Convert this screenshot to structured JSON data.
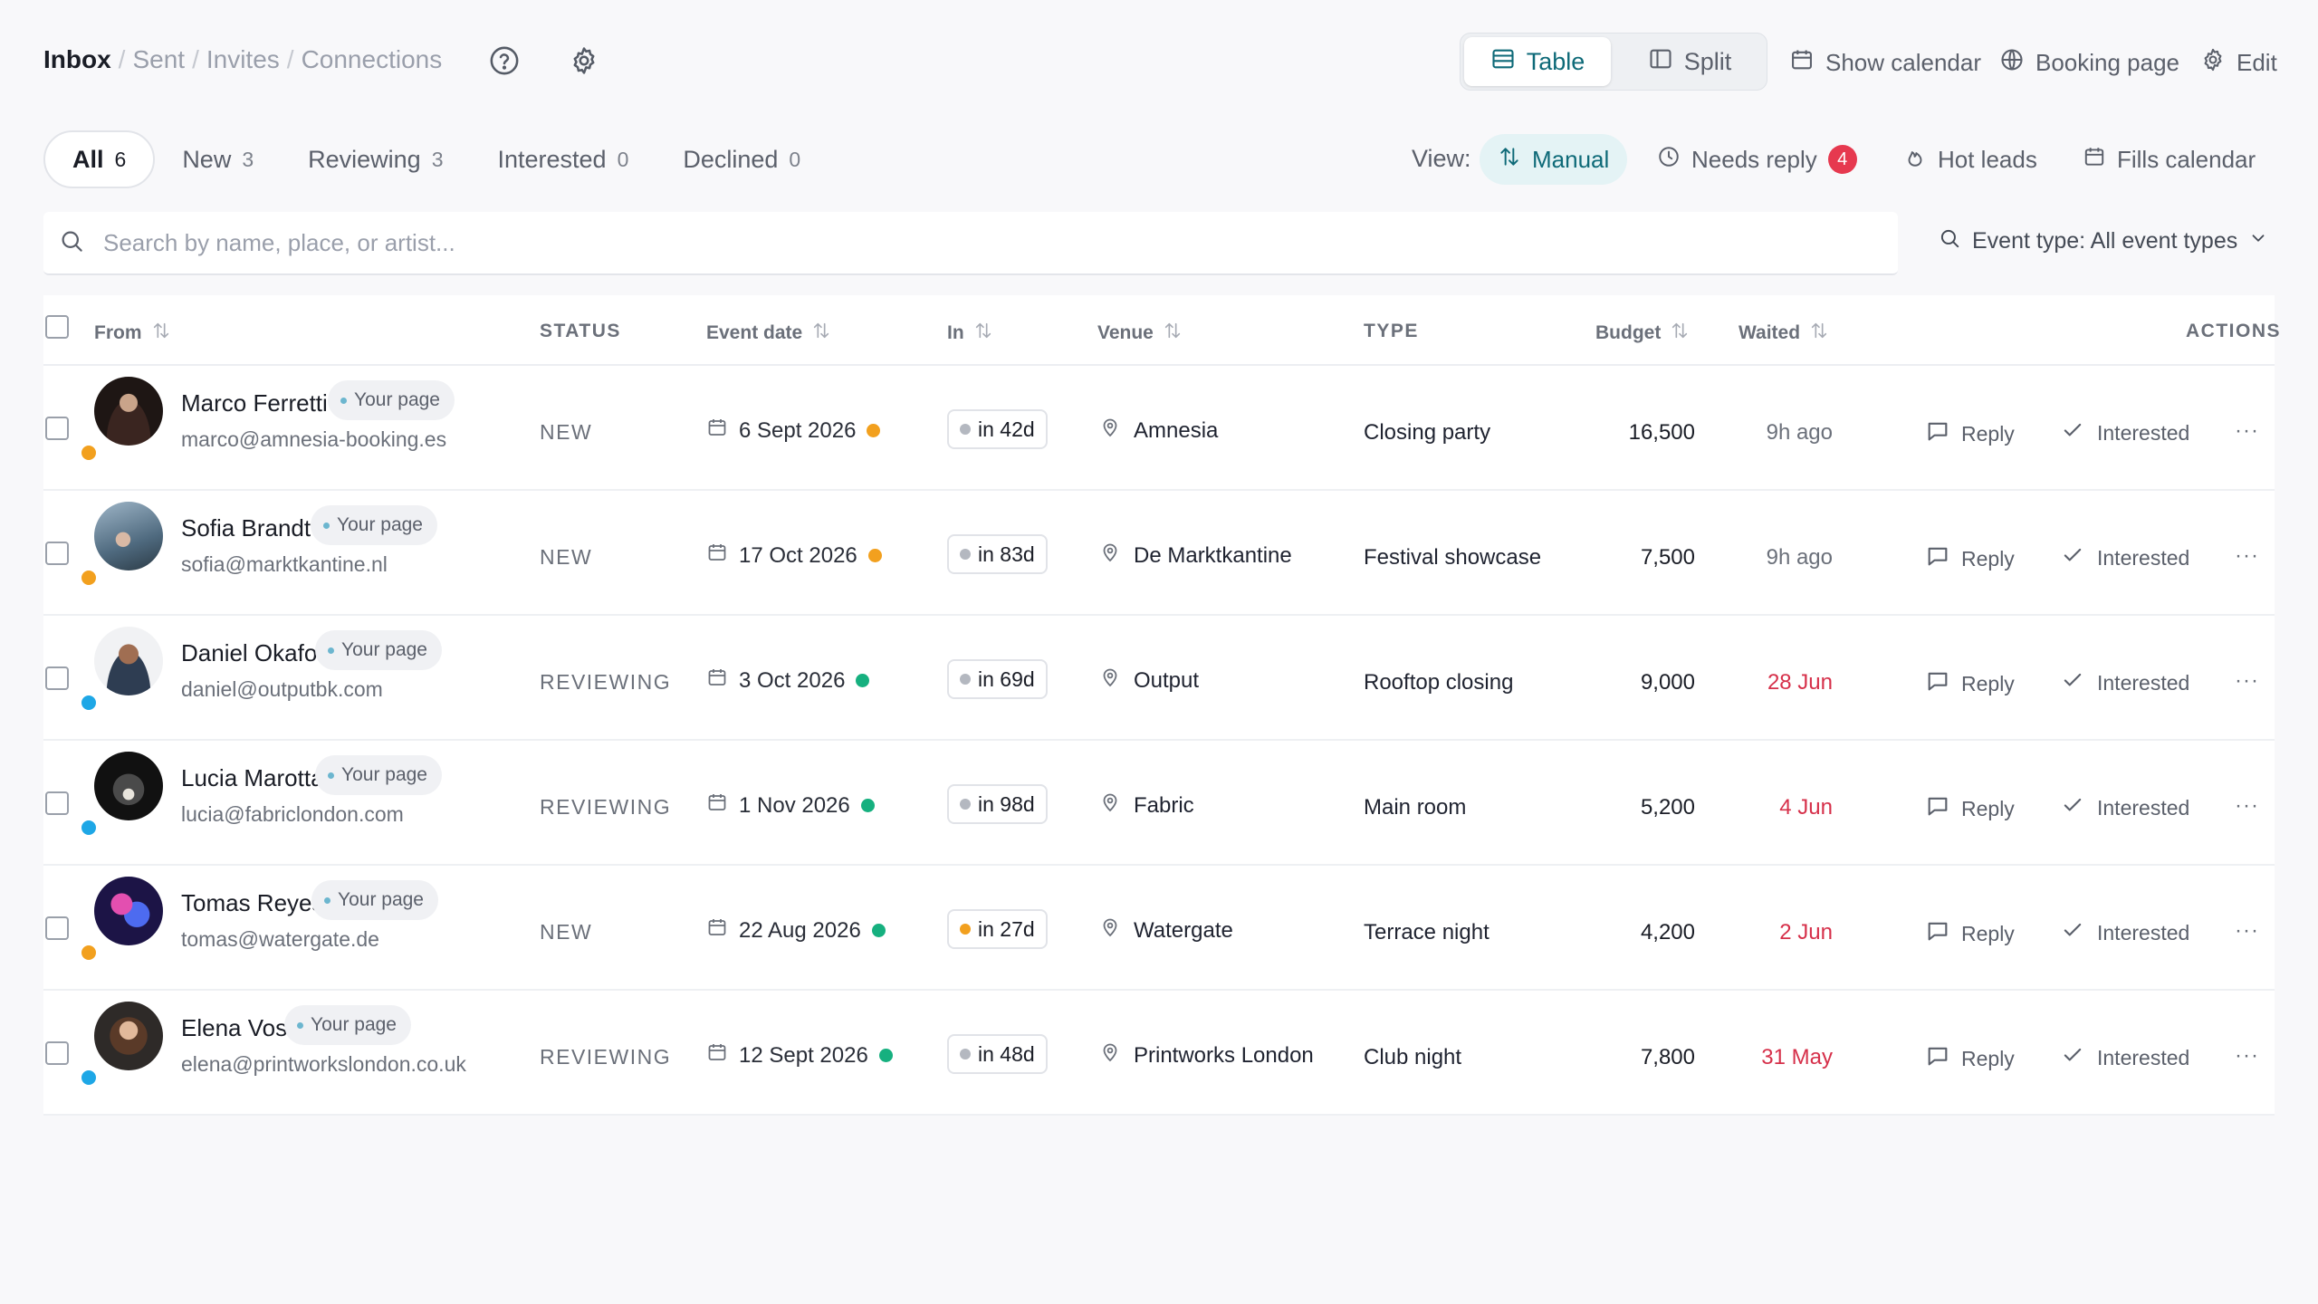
{
  "breadcrumbs": [
    "Inbox",
    "Sent",
    "Invites",
    "Connections"
  ],
  "header": {
    "view_toggle": [
      {
        "label": "Table",
        "icon": "table-icon",
        "active": true
      },
      {
        "label": "Split",
        "icon": "split-icon",
        "active": false
      }
    ],
    "actions": [
      {
        "label": "Show calendar",
        "icon": "calendar-icon"
      },
      {
        "label": "Booking page",
        "icon": "globe-icon"
      },
      {
        "label": "Edit",
        "icon": "gear-icon"
      }
    ]
  },
  "tabs": [
    {
      "label": "All",
      "count": "6",
      "active": true
    },
    {
      "label": "New",
      "count": "3"
    },
    {
      "label": "Reviewing",
      "count": "3"
    },
    {
      "label": "Interested",
      "count": "0"
    },
    {
      "label": "Declined",
      "count": "0"
    }
  ],
  "view": {
    "label": "View:",
    "options": [
      {
        "label": "Manual",
        "icon": "sort-arrows-icon",
        "active": true
      },
      {
        "label": "Needs reply",
        "icon": "clock-icon",
        "badge": "4"
      },
      {
        "label": "Hot leads",
        "icon": "flame-icon"
      },
      {
        "label": "Fills calendar",
        "icon": "calendar-icon"
      }
    ]
  },
  "search": {
    "placeholder": "Search by name, place, or artist..."
  },
  "event_filter": {
    "label": "Event type: All event types"
  },
  "columns": {
    "from": "From",
    "status": "STATUS",
    "event_date": "Event date",
    "in": "In",
    "venue": "Venue",
    "type": "TYPE",
    "budget": "Budget",
    "waited": "Waited",
    "actions": "ACTIONS"
  },
  "row_actions": {
    "reply": "Reply",
    "interested": "Interested",
    "more": "···",
    "your_page": "Your page"
  },
  "colors": {
    "accent": "#0e6a78",
    "orange": "#f2a01e",
    "green": "#16b07f",
    "blue": "#1ea7e6",
    "red_text": "#d6304a",
    "gray": "#b4b8c0"
  },
  "rows": [
    {
      "name": "Marco Ferretti",
      "email": "marco@amnesia-booking.es",
      "status": "NEW",
      "source_dot": "#f2a01e",
      "event_date": "6 Sept 2026",
      "date_dot": "#f2a01e",
      "in": "in 42d",
      "in_dot": "#b4b8c0",
      "venue": "Amnesia",
      "type": "Closing party",
      "budget": "16,500",
      "waited": "9h ago",
      "waited_overdue": false
    },
    {
      "name": "Sofia Brandt",
      "email": "sofia@marktkantine.nl",
      "status": "NEW",
      "source_dot": "#f2a01e",
      "event_date": "17 Oct 2026",
      "date_dot": "#f2a01e",
      "in": "in 83d",
      "in_dot": "#b4b8c0",
      "venue": "De Marktkantine",
      "type": "Festival showcase",
      "budget": "7,500",
      "waited": "9h ago",
      "waited_overdue": false
    },
    {
      "name": "Daniel Okafor",
      "email": "daniel@outputbk.com",
      "status": "REVIEWING",
      "source_dot": "#1ea7e6",
      "event_date": "3 Oct 2026",
      "date_dot": "#16b07f",
      "in": "in 69d",
      "in_dot": "#b4b8c0",
      "venue": "Output",
      "type": "Rooftop closing",
      "budget": "9,000",
      "waited": "28 Jun",
      "waited_overdue": true
    },
    {
      "name": "Lucia Marotta",
      "email": "lucia@fabriclondon.com",
      "status": "REVIEWING",
      "source_dot": "#1ea7e6",
      "event_date": "1 Nov 2026",
      "date_dot": "#16b07f",
      "in": "in 98d",
      "in_dot": "#b4b8c0",
      "venue": "Fabric",
      "type": "Main room",
      "budget": "5,200",
      "waited": "4 Jun",
      "waited_overdue": true
    },
    {
      "name": "Tomas Reyes",
      "email": "tomas@watergate.de",
      "status": "NEW",
      "source_dot": "#f2a01e",
      "event_date": "22 Aug 2026",
      "date_dot": "#16b07f",
      "in": "in 27d",
      "in_dot": "#f2a01e",
      "venue": "Watergate",
      "type": "Terrace night",
      "budget": "4,200",
      "waited": "2 Jun",
      "waited_overdue": true
    },
    {
      "name": "Elena Voss",
      "email": "elena@printworkslondon.co.uk",
      "status": "REVIEWING",
      "source_dot": "#1ea7e6",
      "event_date": "12 Sept 2026",
      "date_dot": "#16b07f",
      "in": "in 48d",
      "in_dot": "#b4b8c0",
      "venue": "Printworks London",
      "type": "Club night",
      "budget": "7,800",
      "waited": "31 May",
      "waited_overdue": true
    }
  ]
}
